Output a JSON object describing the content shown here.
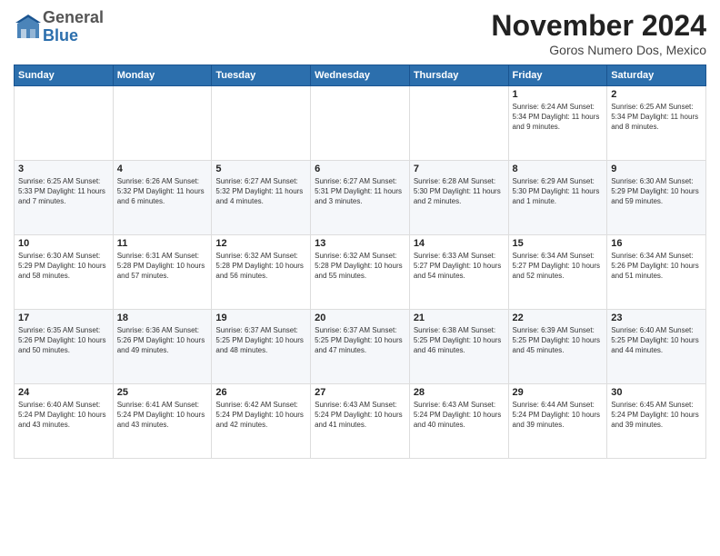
{
  "header": {
    "logo": {
      "general": "General",
      "blue": "Blue"
    },
    "title": "November 2024",
    "subtitle": "Goros Numero Dos, Mexico"
  },
  "days_of_week": [
    "Sunday",
    "Monday",
    "Tuesday",
    "Wednesday",
    "Thursday",
    "Friday",
    "Saturday"
  ],
  "weeks": [
    [
      {
        "day": "",
        "info": ""
      },
      {
        "day": "",
        "info": ""
      },
      {
        "day": "",
        "info": ""
      },
      {
        "day": "",
        "info": ""
      },
      {
        "day": "",
        "info": ""
      },
      {
        "day": "1",
        "info": "Sunrise: 6:24 AM\nSunset: 5:34 PM\nDaylight: 11 hours and 9 minutes."
      },
      {
        "day": "2",
        "info": "Sunrise: 6:25 AM\nSunset: 5:34 PM\nDaylight: 11 hours and 8 minutes."
      }
    ],
    [
      {
        "day": "3",
        "info": "Sunrise: 6:25 AM\nSunset: 5:33 PM\nDaylight: 11 hours and 7 minutes."
      },
      {
        "day": "4",
        "info": "Sunrise: 6:26 AM\nSunset: 5:32 PM\nDaylight: 11 hours and 6 minutes."
      },
      {
        "day": "5",
        "info": "Sunrise: 6:27 AM\nSunset: 5:32 PM\nDaylight: 11 hours and 4 minutes."
      },
      {
        "day": "6",
        "info": "Sunrise: 6:27 AM\nSunset: 5:31 PM\nDaylight: 11 hours and 3 minutes."
      },
      {
        "day": "7",
        "info": "Sunrise: 6:28 AM\nSunset: 5:30 PM\nDaylight: 11 hours and 2 minutes."
      },
      {
        "day": "8",
        "info": "Sunrise: 6:29 AM\nSunset: 5:30 PM\nDaylight: 11 hours and 1 minute."
      },
      {
        "day": "9",
        "info": "Sunrise: 6:30 AM\nSunset: 5:29 PM\nDaylight: 10 hours and 59 minutes."
      }
    ],
    [
      {
        "day": "10",
        "info": "Sunrise: 6:30 AM\nSunset: 5:29 PM\nDaylight: 10 hours and 58 minutes."
      },
      {
        "day": "11",
        "info": "Sunrise: 6:31 AM\nSunset: 5:28 PM\nDaylight: 10 hours and 57 minutes."
      },
      {
        "day": "12",
        "info": "Sunrise: 6:32 AM\nSunset: 5:28 PM\nDaylight: 10 hours and 56 minutes."
      },
      {
        "day": "13",
        "info": "Sunrise: 6:32 AM\nSunset: 5:28 PM\nDaylight: 10 hours and 55 minutes."
      },
      {
        "day": "14",
        "info": "Sunrise: 6:33 AM\nSunset: 5:27 PM\nDaylight: 10 hours and 54 minutes."
      },
      {
        "day": "15",
        "info": "Sunrise: 6:34 AM\nSunset: 5:27 PM\nDaylight: 10 hours and 52 minutes."
      },
      {
        "day": "16",
        "info": "Sunrise: 6:34 AM\nSunset: 5:26 PM\nDaylight: 10 hours and 51 minutes."
      }
    ],
    [
      {
        "day": "17",
        "info": "Sunrise: 6:35 AM\nSunset: 5:26 PM\nDaylight: 10 hours and 50 minutes."
      },
      {
        "day": "18",
        "info": "Sunrise: 6:36 AM\nSunset: 5:26 PM\nDaylight: 10 hours and 49 minutes."
      },
      {
        "day": "19",
        "info": "Sunrise: 6:37 AM\nSunset: 5:25 PM\nDaylight: 10 hours and 48 minutes."
      },
      {
        "day": "20",
        "info": "Sunrise: 6:37 AM\nSunset: 5:25 PM\nDaylight: 10 hours and 47 minutes."
      },
      {
        "day": "21",
        "info": "Sunrise: 6:38 AM\nSunset: 5:25 PM\nDaylight: 10 hours and 46 minutes."
      },
      {
        "day": "22",
        "info": "Sunrise: 6:39 AM\nSunset: 5:25 PM\nDaylight: 10 hours and 45 minutes."
      },
      {
        "day": "23",
        "info": "Sunrise: 6:40 AM\nSunset: 5:25 PM\nDaylight: 10 hours and 44 minutes."
      }
    ],
    [
      {
        "day": "24",
        "info": "Sunrise: 6:40 AM\nSunset: 5:24 PM\nDaylight: 10 hours and 43 minutes."
      },
      {
        "day": "25",
        "info": "Sunrise: 6:41 AM\nSunset: 5:24 PM\nDaylight: 10 hours and 43 minutes."
      },
      {
        "day": "26",
        "info": "Sunrise: 6:42 AM\nSunset: 5:24 PM\nDaylight: 10 hours and 42 minutes."
      },
      {
        "day": "27",
        "info": "Sunrise: 6:43 AM\nSunset: 5:24 PM\nDaylight: 10 hours and 41 minutes."
      },
      {
        "day": "28",
        "info": "Sunrise: 6:43 AM\nSunset: 5:24 PM\nDaylight: 10 hours and 40 minutes."
      },
      {
        "day": "29",
        "info": "Sunrise: 6:44 AM\nSunset: 5:24 PM\nDaylight: 10 hours and 39 minutes."
      },
      {
        "day": "30",
        "info": "Sunrise: 6:45 AM\nSunset: 5:24 PM\nDaylight: 10 hours and 39 minutes."
      }
    ]
  ]
}
